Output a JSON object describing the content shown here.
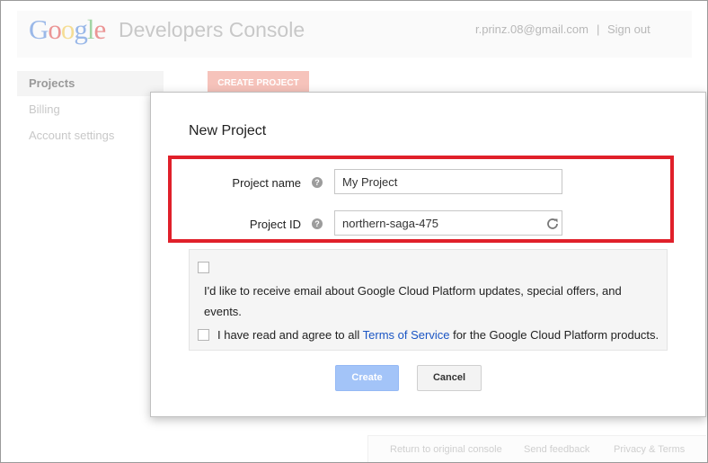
{
  "header": {
    "logo_text": "Google",
    "product": "Developers Console",
    "user_email": "r.prinz.08@gmail.com",
    "separator": "|",
    "sign_out": "Sign out"
  },
  "sidebar": {
    "items": [
      {
        "label": "Projects"
      },
      {
        "label": "Billing"
      },
      {
        "label": "Account settings"
      }
    ]
  },
  "main": {
    "create_project_button": "CREATE PROJECT"
  },
  "dialog": {
    "title": "New Project",
    "project_name_label": "Project name",
    "project_name_value": "My Project",
    "project_id_label": "Project ID",
    "project_id_value": "northern-saga-475",
    "help_glyph": "?",
    "email_opt_in_line1": "I'd like to receive email about Google Cloud Platform updates, special offers, and",
    "email_opt_in_line2": "events.",
    "tos_prefix": "I have read and agree to all ",
    "tos_link": "Terms of Service",
    "tos_suffix": " for the Google Cloud Platform products.",
    "create_label": "Create",
    "cancel_label": "Cancel",
    "highlight_color": "#e0202a"
  },
  "footer": {
    "links": [
      {
        "label": "Return to original console"
      },
      {
        "label": "Send feedback"
      },
      {
        "label": "Privacy & Terms"
      }
    ]
  }
}
